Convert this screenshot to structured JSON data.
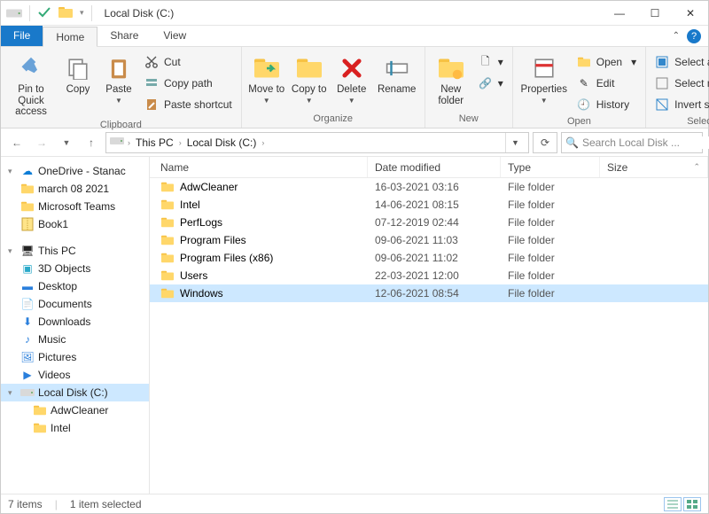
{
  "title": "Local Disk (C:)",
  "tabs": {
    "file": "File",
    "home": "Home",
    "share": "Share",
    "view": "View"
  },
  "ribbon": {
    "clipboard": {
      "label": "Clipboard",
      "pin": "Pin to Quick access",
      "copy": "Copy",
      "paste": "Paste",
      "cut": "Cut",
      "copy_path": "Copy path",
      "paste_shortcut": "Paste shortcut"
    },
    "organize": {
      "label": "Organize",
      "move": "Move to",
      "copy": "Copy to",
      "delete": "Delete",
      "rename": "Rename"
    },
    "new": {
      "label": "New",
      "new_folder": "New folder"
    },
    "open": {
      "label": "Open",
      "properties": "Properties",
      "open": "Open",
      "edit": "Edit",
      "history": "History"
    },
    "select": {
      "label": "Select",
      "all": "Select all",
      "none": "Select none",
      "invert": "Invert selection"
    }
  },
  "breadcrumb": {
    "this_pc": "This PC",
    "drive": "Local Disk (C:)"
  },
  "search": {
    "placeholder": "Search Local Disk ..."
  },
  "columns": {
    "name": "Name",
    "date": "Date modified",
    "type": "Type",
    "size": "Size"
  },
  "tree": {
    "onedrive": "OneDrive - Stanac",
    "march": "march 08 2021",
    "teams": "Microsoft Teams",
    "book1": "Book1",
    "this_pc": "This PC",
    "objects3d": "3D Objects",
    "desktop": "Desktop",
    "documents": "Documents",
    "downloads": "Downloads",
    "music": "Music",
    "pictures": "Pictures",
    "videos": "Videos",
    "local_disk": "Local Disk (C:)",
    "adw": "AdwCleaner",
    "intel": "Intel"
  },
  "rows": [
    {
      "name": "AdwCleaner",
      "date": "16-03-2021 03:16",
      "type": "File folder",
      "selected": false
    },
    {
      "name": "Intel",
      "date": "14-06-2021 08:15",
      "type": "File folder",
      "selected": false
    },
    {
      "name": "PerfLogs",
      "date": "07-12-2019 02:44",
      "type": "File folder",
      "selected": false
    },
    {
      "name": "Program Files",
      "date": "09-06-2021 11:03",
      "type": "File folder",
      "selected": false
    },
    {
      "name": "Program Files (x86)",
      "date": "09-06-2021 11:02",
      "type": "File folder",
      "selected": false
    },
    {
      "name": "Users",
      "date": "22-03-2021 12:00",
      "type": "File folder",
      "selected": false
    },
    {
      "name": "Windows",
      "date": "12-06-2021 08:54",
      "type": "File folder",
      "selected": true
    }
  ],
  "status": {
    "count": "7 items",
    "selected": "1 item selected"
  }
}
